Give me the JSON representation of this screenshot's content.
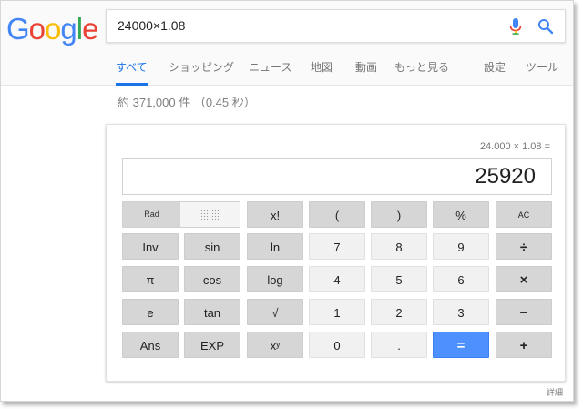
{
  "logo": {
    "letters": [
      "G",
      "o",
      "o",
      "g",
      "l",
      "e"
    ],
    "colors": [
      "#4285F4",
      "#EA4335",
      "#FBBC05",
      "#4285F4",
      "#34A853",
      "#EA4335"
    ]
  },
  "search": {
    "query": "24000×1.08",
    "mic_icon": "mic-icon",
    "search_icon": "search-icon"
  },
  "tabs": [
    {
      "label": "すべて",
      "active": true
    },
    {
      "label": "ショッピング",
      "active": false
    },
    {
      "label": "ニュース",
      "active": false
    },
    {
      "label": "地図",
      "active": false
    },
    {
      "label": "動画",
      "active": false
    },
    {
      "label": "もっと見る",
      "active": false
    },
    {
      "label": "設定",
      "active": false
    },
    {
      "label": "ツール",
      "active": false
    }
  ],
  "result_stats": "約 371,000 件 （0.45 秒）",
  "calculator": {
    "equation": "24.000 × 1.08 =",
    "result": "25920",
    "rad_label": "Rad",
    "buttons": [
      [
        "x!",
        "(",
        ")",
        "%",
        "AC"
      ],
      [
        "Inv",
        "sin",
        "ln",
        "7",
        "8",
        "9",
        "÷"
      ],
      [
        "π",
        "cos",
        "log",
        "4",
        "5",
        "6",
        "×"
      ],
      [
        "e",
        "tan",
        "√",
        "1",
        "2",
        "3",
        "−"
      ],
      [
        "Ans",
        "EXP",
        "xʸ",
        "0",
        ".",
        "=",
        "+"
      ]
    ]
  },
  "detail_link": "詳細",
  "colors": {
    "accent": "#1a73e8",
    "equals_button": "#4d90fe"
  }
}
